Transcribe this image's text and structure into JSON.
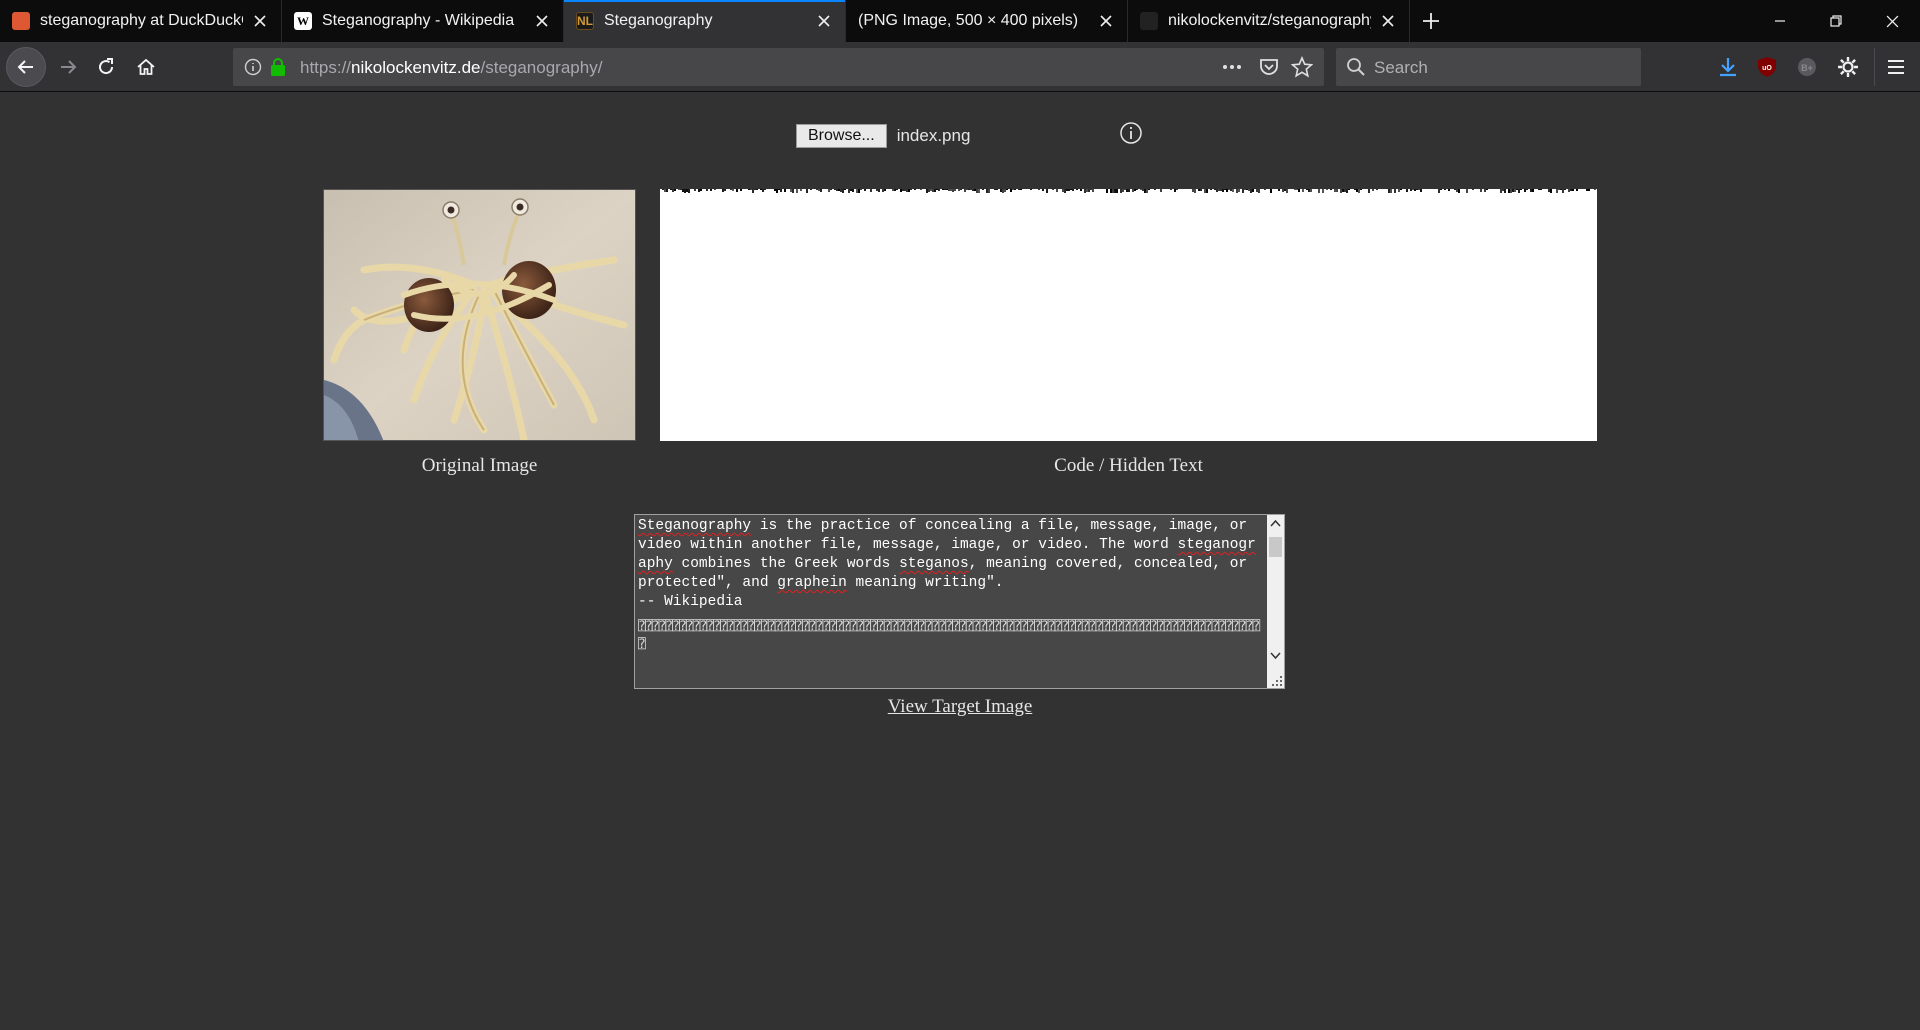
{
  "tabs": [
    {
      "title": "steganography at DuckDuckGo",
      "favicon": "duckduckgo-icon"
    },
    {
      "title": "Steganography - Wikipedia",
      "favicon": "wikipedia-icon"
    },
    {
      "title": "Steganography",
      "favicon": "nl-site-icon",
      "active": true
    },
    {
      "title": "(PNG Image, 500 × 400 pixels)",
      "favicon": ""
    },
    {
      "title": "nikolockenvitz/steganography:",
      "favicon": "github-icon"
    }
  ],
  "favicon_text": {
    "wikipedia": "W",
    "nl": "NL"
  },
  "navbar": {
    "url_prefix": "https://",
    "url_host": "nikolockenvitz.de",
    "url_path": "/steganography/",
    "search_placeholder": "Search"
  },
  "page": {
    "browse_label": "Browse...",
    "file_name": "index.png",
    "caption_original": "Original Image",
    "caption_code": "Code / Hidden Text",
    "link_label": "View Target Image",
    "textarea": {
      "line1_a": "",
      "line1_spell": "Steganography",
      "line1_b": " is the practice of concealing a file, message, image, or video within another file, message, image, or video. The word ",
      "line2_spell": "steganography",
      "line2_b": " combines the Greek words ",
      "line3_spell": "steganos",
      "line3_b": ", meaning covered, concealed, or protected\", and ",
      "line4_spell": "graphein",
      "line4_b": " meaning writing\".\n-- Wikipedia\n",
      "glyph_rows": "⍰⍰⍰⍰⍰⍰⍰⍰⍰⍰⍰⍰⍰⍰⍰⍰⍰⍰⍰⍰⍰⍰⍰⍰⍰⍰⍰⍰⍰⍰⍰⍰⍰⍰⍰⍰⍰⍰⍰⍰⍰⍰⍰⍰⍰⍰⍰⍰⍰⍰⍰⍰⍰⍰⍰⍰⍰⍰⍰⍰⍰⍰⍰⍰⍰⍰⍰⍰⍰⍰⍰⍰⍰⍰⍰⍰⍰⍰⍰⍰⍰⍰⍰⍰⍰⍰⍰⍰⍰⍰⍰⍰"
    }
  },
  "colors": {
    "accent": "#0a84ff",
    "page_bg": "#323232",
    "tabstrip_bg": "#0c0c0d"
  }
}
